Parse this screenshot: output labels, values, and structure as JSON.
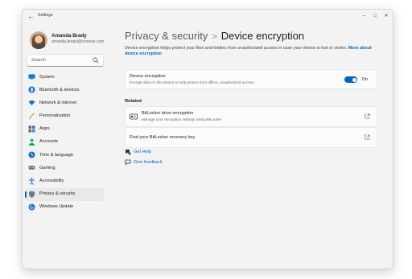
{
  "titlebar": {
    "app_title": "Settings",
    "back_glyph": "←",
    "minimize_glyph": "–",
    "maximize_glyph": "□",
    "close_glyph": "✕"
  },
  "user": {
    "name": "Amanda Brady",
    "email": "amanda.brady@contoso.com"
  },
  "search": {
    "placeholder": "Search"
  },
  "sidebar": {
    "items": [
      {
        "label": "System",
        "icon": "monitor-icon",
        "active": false
      },
      {
        "label": "Bluetooth & devices",
        "icon": "bluetooth-icon",
        "active": false
      },
      {
        "label": "Network & internet",
        "icon": "wifi-icon",
        "active": false
      },
      {
        "label": "Personalization",
        "icon": "brush-icon",
        "active": false
      },
      {
        "label": "Apps",
        "icon": "apps-icon",
        "active": false
      },
      {
        "label": "Accounts",
        "icon": "person-icon",
        "active": false
      },
      {
        "label": "Time & language",
        "icon": "globe-clock-icon",
        "active": false
      },
      {
        "label": "Gaming",
        "icon": "gamepad-icon",
        "active": false
      },
      {
        "label": "Accessibility",
        "icon": "accessibility-icon",
        "active": false
      },
      {
        "label": "Privacy & security",
        "icon": "shield-icon",
        "active": true
      },
      {
        "label": "Windows Update",
        "icon": "update-icon",
        "active": false
      }
    ]
  },
  "header": {
    "parent": "Privacy & security",
    "separator": ">",
    "current": "Device encryption"
  },
  "description": {
    "text": "Device encryption helps protect your files and folders from unauthorized access in case your device is lost or stolen.",
    "link": "More about device encryption"
  },
  "encryption": {
    "title": "Device encryption",
    "subtitle": "Encrypt data on this device to help protect from offline, unauthorized access",
    "toggle_state": "On",
    "enabled": true
  },
  "related": {
    "heading": "Related",
    "bitlocker": {
      "title": "BitLocker drive encryption",
      "subtitle": "Manage your encryption settings using BitLocker"
    },
    "recovery": {
      "title": "Find your BitLocker recovery key"
    }
  },
  "help": {
    "get_help": "Get Help",
    "give_feedback": "Give feedback"
  },
  "colors": {
    "accent": "#0067c0",
    "window_bg": "#f3f3f3",
    "card_bg": "#fbfbfb"
  }
}
